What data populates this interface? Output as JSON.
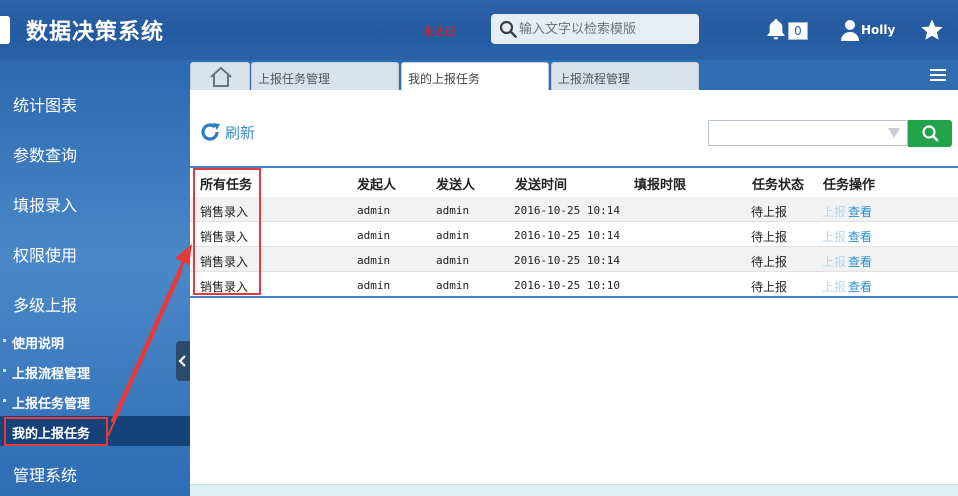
{
  "header": {
    "app_title": "数据决策系统",
    "unregistered_label": "未注册",
    "search_placeholder": "输入文字以检索模版",
    "notification_count": "0",
    "user_name": "Holly"
  },
  "sidebar": {
    "items": [
      {
        "label": "统计图表"
      },
      {
        "label": "参数查询"
      },
      {
        "label": "填报录入"
      },
      {
        "label": "权限使用"
      },
      {
        "label": "多级上报"
      }
    ],
    "sub_items": [
      {
        "label": "使用说明"
      },
      {
        "label": "上报流程管理"
      },
      {
        "label": "上报任务管理"
      },
      {
        "label": "我的上报任务"
      }
    ],
    "last_item": {
      "label": "管理系统"
    }
  },
  "tabs": [
    {
      "label": "上报任务管理"
    },
    {
      "label": "我的上报任务"
    },
    {
      "label": "上报流程管理"
    }
  ],
  "toolbar": {
    "refresh_label": "刷新"
  },
  "table": {
    "headers": [
      "所有任务",
      "发起人",
      "发送人",
      "发送时间",
      "填报时限",
      "任务状态",
      "任务操作"
    ],
    "rows": [
      {
        "task": "销售录入",
        "initiator": "admin",
        "sender": "admin",
        "time": "2016-10-25 10:14",
        "deadline": "",
        "status": "待上报",
        "action1": "上报",
        "action2": "查看"
      },
      {
        "task": "销售录入",
        "initiator": "admin",
        "sender": "admin",
        "time": "2016-10-25 10:14",
        "deadline": "",
        "status": "待上报",
        "action1": "上报",
        "action2": "查看"
      },
      {
        "task": "销售录入",
        "initiator": "admin",
        "sender": "admin",
        "time": "2016-10-25 10:14",
        "deadline": "",
        "status": "待上报",
        "action1": "上报",
        "action2": "查看"
      },
      {
        "task": "销售录入",
        "initiator": "admin",
        "sender": "admin",
        "time": "2016-10-25 10:10",
        "deadline": "",
        "status": "待上报",
        "action1": "上报",
        "action2": "查看"
      }
    ]
  },
  "colors": {
    "header_bg": "#2f62a6",
    "sidebar_active": "#16427a",
    "accent_blue": "#3a86c8",
    "search_button": "#22a34a",
    "annotation_red": "#e53b3b",
    "unregistered_red": "#e02020"
  },
  "icons": [
    "logo-mark",
    "search-icon",
    "bell-icon",
    "user-icon",
    "star-icon",
    "home-icon",
    "menu-icon",
    "refresh-icon",
    "dropdown-arrow-icon",
    "collapse-arrow-icon"
  ]
}
